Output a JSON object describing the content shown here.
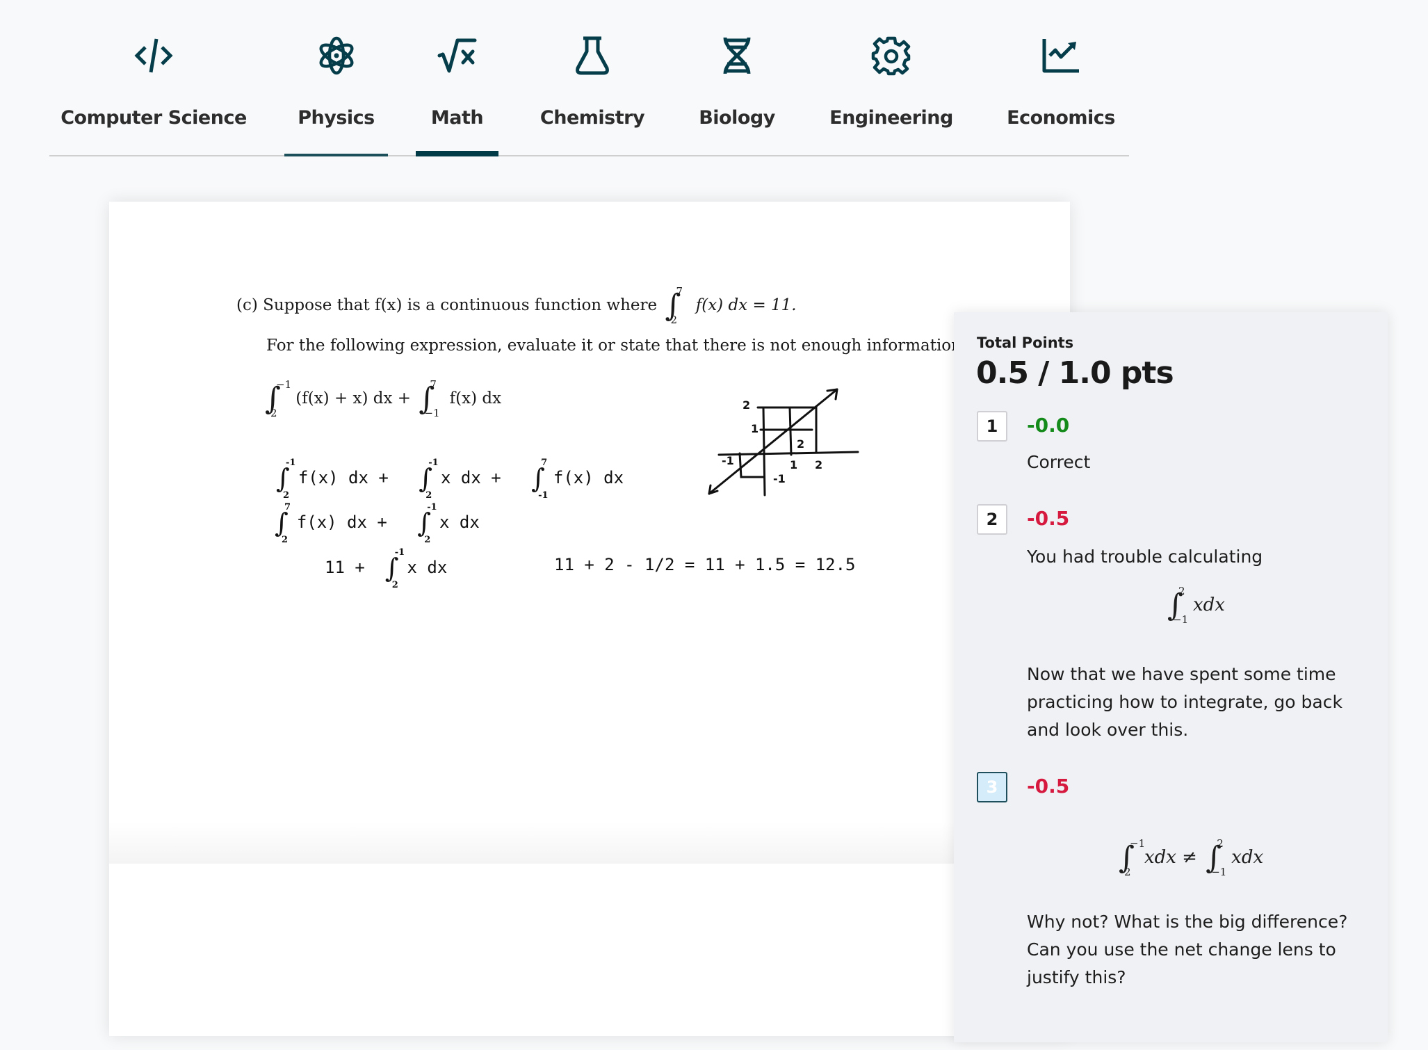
{
  "tabs": [
    {
      "label": "Computer Science",
      "icon": "code-icon"
    },
    {
      "label": "Physics",
      "icon": "atom-icon"
    },
    {
      "label": "Math",
      "icon": "square-root-icon"
    },
    {
      "label": "Chemistry",
      "icon": "flask-icon"
    },
    {
      "label": "Biology",
      "icon": "dna-icon"
    },
    {
      "label": "Engineering",
      "icon": "gear-icon"
    },
    {
      "label": "Economics",
      "icon": "chart-line-icon"
    }
  ],
  "active_tab": "Math",
  "hover_tab": "Physics",
  "colors": {
    "icon": "#053d4a",
    "active_underline": "#003b47",
    "hover_underline": "#1b4f5a",
    "points_ok": "#138a1a",
    "points_deduct": "#d6193e"
  },
  "document": {
    "part_label": "(c)",
    "line1_text": "Suppose that f(x) is a continuous function where",
    "line1_integral": {
      "lower": "2",
      "upper": "7",
      "integrand": "f(x) dx = 11."
    },
    "line2_text": "For the following expression, evaluate it or state that there is not enough information.",
    "expression": {
      "term1": {
        "lower": "2",
        "upper": "−1",
        "integrand": "(f(x) + x)  dx +"
      },
      "term2": {
        "lower": "−1",
        "upper": "7",
        "integrand": "f(x) dx"
      }
    },
    "handwritten": {
      "row1": [
        {
          "lower": "2",
          "upper": "-1",
          "integrand": "f(x) dx  +"
        },
        {
          "lower": "2",
          "upper": "-1",
          "integrand": "x dx  +"
        },
        {
          "lower": "-1",
          "upper": "7",
          "integrand": "f(x) dx"
        }
      ],
      "row2": [
        {
          "lower": "2",
          "upper": "7",
          "integrand": "f(x) dx    +"
        },
        {
          "lower": "2",
          "upper": "-1",
          "integrand": "x dx"
        }
      ],
      "row3_prefix": "11    +",
      "row3_integral": {
        "lower": "2",
        "upper": "-1",
        "integrand": "x dx"
      },
      "row3_result": "11 + 2 - 1/2 = 11 + 1.5 = 12.5",
      "sketch_labels": {
        "y_top": "2",
        "y_mid": "1",
        "x_one": "1",
        "x_two": "2",
        "area": "2",
        "neg_x": "-1",
        "neg_y": "-1"
      }
    }
  },
  "grading": {
    "total_label": "Total Points",
    "score": "0.5 / 1.0 pts",
    "rubric": [
      {
        "number": "1",
        "points": "-0.0",
        "status": "ok",
        "selected": false,
        "comment": "Correct"
      },
      {
        "number": "2",
        "points": "-0.5",
        "status": "deduct",
        "selected": false,
        "comment": "You had trouble calculating",
        "formula": {
          "lower": "−1",
          "upper": "2",
          "integrand": "xdx"
        },
        "comment2": "Now that we have spent some time practicing how to integrate, go back and look over this."
      },
      {
        "number": "3",
        "points": "-0.5",
        "status": "deduct",
        "selected": true,
        "formula_left": {
          "lower": "2",
          "upper": "−1",
          "integrand": "xdx ≠"
        },
        "formula_right": {
          "lower": "−1",
          "upper": "2",
          "integrand": "xdx"
        },
        "comment2": "Why not? What is the big difference? Can you use the net change lens to justify this?"
      }
    ]
  }
}
